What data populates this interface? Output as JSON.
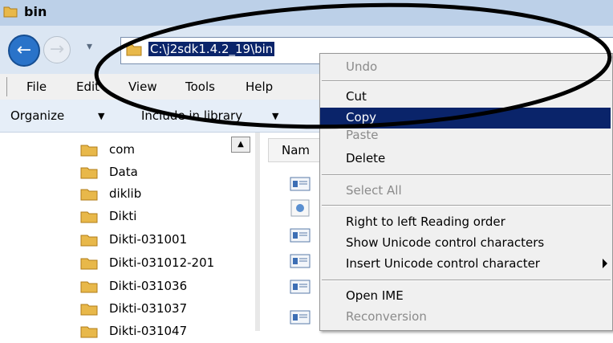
{
  "window": {
    "title": "bin"
  },
  "address": {
    "path": "C:\\j2sdk1.4.2_19\\bin"
  },
  "menu": {
    "items": [
      "File",
      "Edit",
      "View",
      "Tools",
      "Help"
    ]
  },
  "toolbar": {
    "organize": "Organize",
    "include": "Include in library",
    "arrow": "▼"
  },
  "tree": {
    "items": [
      "com",
      "Data",
      "diklib",
      "Dikti",
      "Dikti-031001",
      "Dikti-031012-201",
      "Dikti-031036",
      "Dikti-031037",
      "Dikti-031047"
    ]
  },
  "filelist": {
    "header": "Nam"
  },
  "context_menu": {
    "items": [
      {
        "label": "Undo",
        "state": "disabled"
      },
      {
        "label": "Cut",
        "state": "normal"
      },
      {
        "label": "Copy",
        "state": "highlighted"
      },
      {
        "label": "Paste",
        "state": "disabled"
      },
      {
        "label": "Delete",
        "state": "normal"
      },
      {
        "label": "Select All",
        "state": "disabled"
      },
      {
        "label": "Right to left Reading order",
        "state": "normal"
      },
      {
        "label": "Show Unicode control characters",
        "state": "normal"
      },
      {
        "label": "Insert Unicode control character",
        "state": "normal",
        "submenu": true
      },
      {
        "label": "Open IME",
        "state": "normal"
      },
      {
        "label": "Reconversion",
        "state": "disabled"
      }
    ]
  },
  "colors": {
    "highlight": "#0a246a",
    "disabled_text": "#8b8b8b",
    "folder": "#e8b84a"
  }
}
